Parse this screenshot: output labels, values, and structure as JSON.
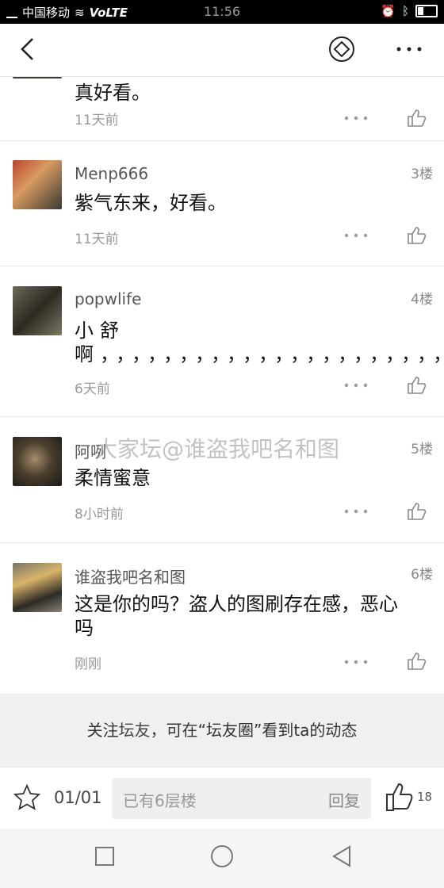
{
  "status": {
    "carrier": "中国移动",
    "network": "VoLTE",
    "time": "11:56"
  },
  "nav": {
    "back_icon": "chevron-left-icon",
    "share_icon": "diamond-ring-icon",
    "more_icon": "more-horizontal-icon"
  },
  "posts": [
    {
      "text": "真好看。",
      "time": "11天前"
    },
    {
      "user": "Menp666",
      "floor": "3楼",
      "text": "紫气东来，好看。",
      "time": "11天前"
    },
    {
      "user": "popwlife",
      "floor": "4楼",
      "text": "小舒啊，，，，，，，，，，，，，，，，，，，，，，，，，，，，",
      "time": "6天前"
    },
    {
      "user": "阿咧",
      "floor": "5楼",
      "text": "柔情蜜意",
      "time": "8小时前"
    },
    {
      "user": "谁盗我吧名和图",
      "floor": "6楼",
      "text": "这是你的吗？盗人的图刷存在感，恶心吗",
      "time": "刚刚"
    }
  ],
  "watermark": "大家坛@谁盗我吧名和图",
  "follow_banner": {
    "part1": "关注",
    "part2": "坛友",
    "part3": "，可在“",
    "part4": "坛友圈",
    "part5": "”看到ta的动态"
  },
  "bottom": {
    "page": "01/01",
    "placeholder": "已有6层楼",
    "reply": "回复",
    "likes": "18"
  }
}
